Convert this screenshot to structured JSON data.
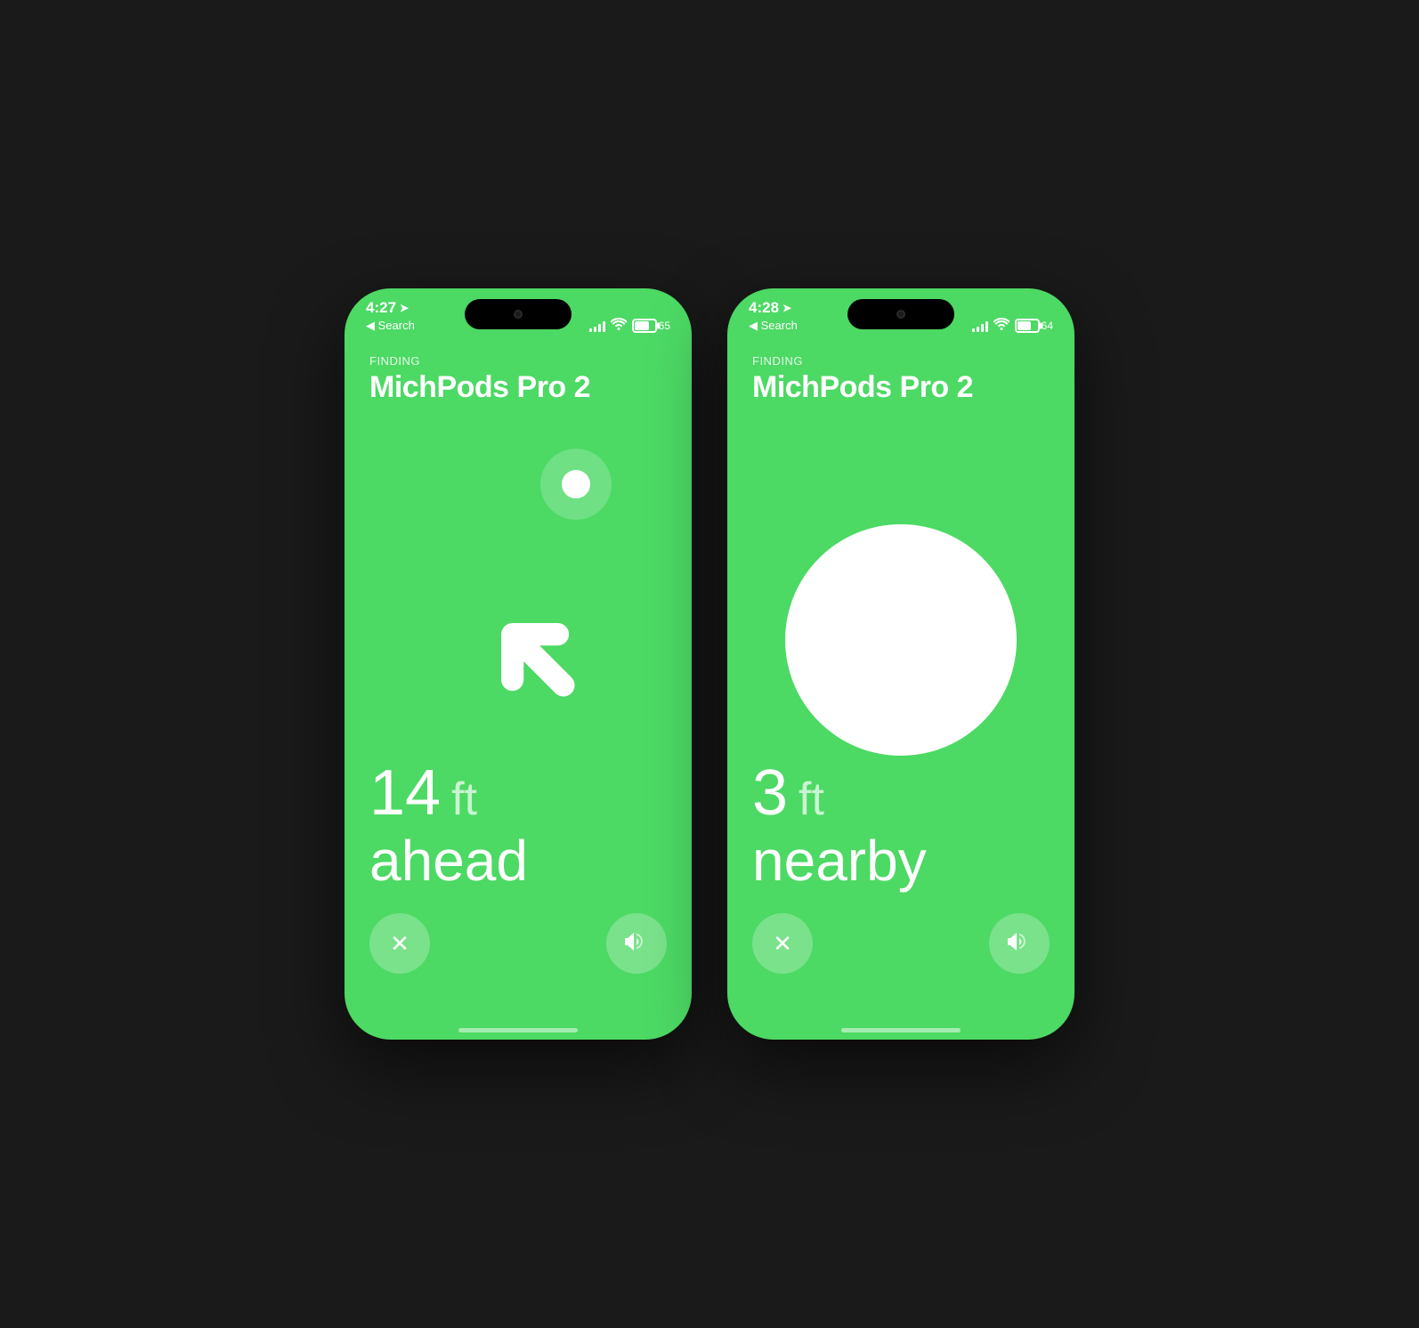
{
  "phone1": {
    "time": "4:27",
    "back_label": "◀ Search",
    "battery_percent": "65",
    "battery_width": "75%",
    "finding_label": "FINDING",
    "device_name": "MichPods Pro 2",
    "distance_number": "14",
    "distance_unit": "ft",
    "direction_text": "ahead",
    "close_button_label": "×",
    "sound_button_label": "🔊"
  },
  "phone2": {
    "time": "4:28",
    "back_label": "◀ Search",
    "battery_percent": "64",
    "battery_width": "72%",
    "finding_label": "FINDING",
    "device_name": "MichPods Pro 2",
    "distance_number": "3",
    "distance_unit": "ft",
    "direction_text": "nearby",
    "close_button_label": "×",
    "sound_button_label": "🔊"
  },
  "colors": {
    "bg": "#4cd964",
    "text_white": "#ffffff",
    "text_dim": "rgba(255,255,255,0.7)"
  }
}
